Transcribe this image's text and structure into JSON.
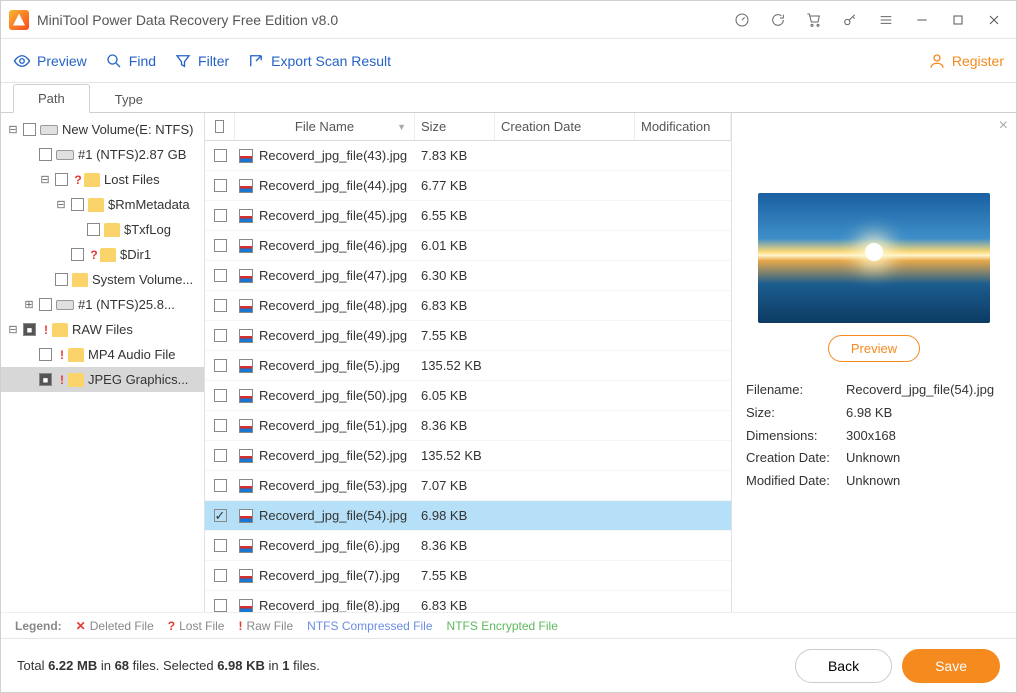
{
  "title": "MiniTool Power Data Recovery Free Edition v8.0",
  "toolbar": {
    "preview": "Preview",
    "find": "Find",
    "filter": "Filter",
    "export": "Export Scan Result",
    "register": "Register"
  },
  "tabs": {
    "path": "Path",
    "type": "Type"
  },
  "tree": [
    {
      "indent": 0,
      "toggle": "−",
      "check": "blank",
      "icon": "drive",
      "label": "New Volume(E: NTFS)"
    },
    {
      "indent": 1,
      "toggle": "",
      "check": "blank",
      "icon": "drive",
      "label": "#1 (NTFS)2.87 GB"
    },
    {
      "indent": 2,
      "toggle": "−",
      "check": "blank",
      "icon": "mark-q",
      "label": "Lost Files"
    },
    {
      "indent": 3,
      "toggle": "−",
      "check": "blank",
      "icon": "folder",
      "label": "$RmMetadata"
    },
    {
      "indent": 4,
      "toggle": "",
      "check": "blank",
      "icon": "folder",
      "label": "$TxfLog"
    },
    {
      "indent": 3,
      "toggle": "",
      "check": "blank",
      "icon": "mark-q",
      "label": "$Dir1"
    },
    {
      "indent": 2,
      "toggle": "",
      "check": "blank",
      "icon": "folder",
      "label": "System Volume..."
    },
    {
      "indent": 1,
      "toggle": "+",
      "check": "blank",
      "icon": "drive",
      "label": "#1 (NTFS)25.8..."
    },
    {
      "indent": 0,
      "toggle": "−",
      "check": "filled",
      "icon": "mark-e",
      "label": "RAW Files"
    },
    {
      "indent": 1,
      "toggle": "",
      "check": "blank",
      "icon": "mark-e",
      "label": "MP4 Audio File"
    },
    {
      "indent": 1,
      "toggle": "",
      "check": "filled",
      "icon": "mark-e",
      "label": "JPEG Graphics...",
      "selected": true
    }
  ],
  "columns": {
    "name": "File Name",
    "size": "Size",
    "creation": "Creation Date",
    "modification": "Modification"
  },
  "files": [
    {
      "name": "Recoverd_jpg_file(43).jpg",
      "size": "7.83 KB"
    },
    {
      "name": "Recoverd_jpg_file(44).jpg",
      "size": "6.77 KB"
    },
    {
      "name": "Recoverd_jpg_file(45).jpg",
      "size": "6.55 KB"
    },
    {
      "name": "Recoverd_jpg_file(46).jpg",
      "size": "6.01 KB"
    },
    {
      "name": "Recoverd_jpg_file(47).jpg",
      "size": "6.30 KB"
    },
    {
      "name": "Recoverd_jpg_file(48).jpg",
      "size": "6.83 KB"
    },
    {
      "name": "Recoverd_jpg_file(49).jpg",
      "size": "7.55 KB"
    },
    {
      "name": "Recoverd_jpg_file(5).jpg",
      "size": "135.52 KB"
    },
    {
      "name": "Recoverd_jpg_file(50).jpg",
      "size": "6.05 KB"
    },
    {
      "name": "Recoverd_jpg_file(51).jpg",
      "size": "8.36 KB"
    },
    {
      "name": "Recoverd_jpg_file(52).jpg",
      "size": "135.52 KB"
    },
    {
      "name": "Recoverd_jpg_file(53).jpg",
      "size": "7.07 KB"
    },
    {
      "name": "Recoverd_jpg_file(54).jpg",
      "size": "6.98 KB",
      "checked": true,
      "selected": true
    },
    {
      "name": "Recoverd_jpg_file(6).jpg",
      "size": "8.36 KB"
    },
    {
      "name": "Recoverd_jpg_file(7).jpg",
      "size": "7.55 KB"
    },
    {
      "name": "Recoverd_jpg_file(8).jpg",
      "size": "6.83 KB"
    }
  ],
  "preview": {
    "button": "Preview",
    "filename_k": "Filename:",
    "filename_v": "Recoverd_jpg_file(54).jpg",
    "size_k": "Size:",
    "size_v": "6.98 KB",
    "dim_k": "Dimensions:",
    "dim_v": "300x168",
    "cdate_k": "Creation Date:",
    "cdate_v": "Unknown",
    "mdate_k": "Modified Date:",
    "mdate_v": "Unknown"
  },
  "legend": {
    "label": "Legend:",
    "deleted": "Deleted File",
    "lost": "Lost File",
    "raw": "Raw File",
    "compressed": "NTFS Compressed File",
    "encrypted": "NTFS Encrypted File"
  },
  "footer": {
    "stats_pre": "Total ",
    "total_size": "6.22 MB",
    "stats_mid1": " in ",
    "total_files": "68",
    "stats_mid2": " files.  Selected ",
    "sel_size": "6.98 KB",
    "stats_mid3": " in ",
    "sel_files": "1",
    "stats_post": " files.",
    "back": "Back",
    "save": "Save"
  }
}
